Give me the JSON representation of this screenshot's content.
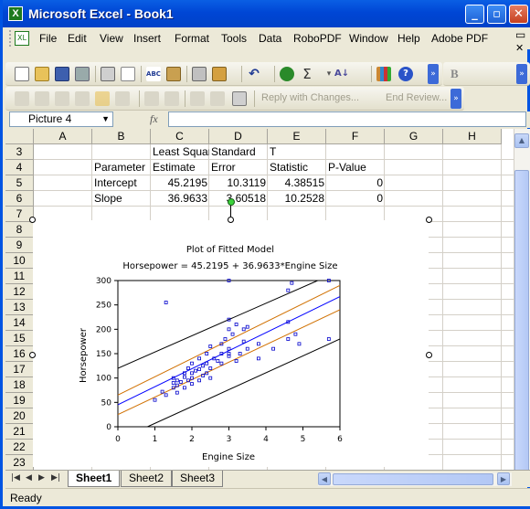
{
  "window": {
    "title": "Microsoft Excel - Book1",
    "app_icon": "X"
  },
  "menu": {
    "items": [
      "File",
      "Edit",
      "View",
      "Insert",
      "Format",
      "Tools",
      "Data",
      "RoboPDF",
      "Window",
      "Help",
      "Adobe PDF"
    ],
    "mdi_minimize": "▭",
    "mdi_close": "✕"
  },
  "toolbar2": {
    "reply_label": "Reply with Changes...",
    "end_review_label": "End Review..."
  },
  "formula_bar": {
    "name_box": "Picture 4",
    "fx": "fx",
    "content": ""
  },
  "sheet": {
    "columns": [
      "A",
      "B",
      "C",
      "D",
      "E",
      "F",
      "G",
      "H"
    ],
    "rows": [
      "3",
      "4",
      "5",
      "6",
      "7",
      "8",
      "9",
      "10",
      "11",
      "12",
      "13",
      "14",
      "15",
      "16",
      "17",
      "18",
      "19",
      "20",
      "21",
      "22",
      "23"
    ],
    "cells": {
      "C3": "Least Squares",
      "D3": "Standard",
      "E3": "T",
      "B4": "Parameter",
      "C4": "Estimate",
      "D4": "Error",
      "E4": "Statistic",
      "F4": "P-Value",
      "B5": "Intercept",
      "C5": "45.2195",
      "D5": "10.3119",
      "E5": "4.38515",
      "F5": "0",
      "B6": "Slope",
      "C6": "36.9633",
      "D6": "3.60518",
      "E6": "10.2528",
      "F6": "0"
    }
  },
  "chart_data": {
    "type": "scatter",
    "title": "Plot of Fitted Model",
    "subtitle": "Horsepower = 45.2195 + 36.9633*Engine Size",
    "xlabel": "Engine Size",
    "ylabel": "Horsepower",
    "xlim": [
      0,
      6
    ],
    "ylim": [
      0,
      300
    ],
    "xticks": [
      0,
      1,
      2,
      3,
      4,
      5,
      6
    ],
    "yticks": [
      0,
      50,
      100,
      150,
      200,
      250,
      300
    ],
    "fit": {
      "intercept": 45.2195,
      "slope": 36.9633
    },
    "confidence_band": {
      "lower": [
        [
          0,
          25
        ],
        [
          6,
          240
        ]
      ],
      "upper": [
        [
          0,
          65
        ],
        [
          6,
          290
        ]
      ]
    },
    "prediction_band": {
      "lower": [
        [
          0.8,
          0
        ],
        [
          6,
          180
        ]
      ],
      "upper": [
        [
          0,
          120
        ],
        [
          5.4,
          300
        ]
      ]
    },
    "colors": {
      "points": "#0000cc",
      "fit": "#0000ff",
      "confidence": "#d07000",
      "prediction": "#000000"
    },
    "points": [
      [
        1.0,
        55
      ],
      [
        1.2,
        72
      ],
      [
        1.3,
        65
      ],
      [
        1.3,
        255
      ],
      [
        1.5,
        80
      ],
      [
        1.5,
        90
      ],
      [
        1.5,
        100
      ],
      [
        1.6,
        70
      ],
      [
        1.6,
        95
      ],
      [
        1.6,
        85
      ],
      [
        1.7,
        92
      ],
      [
        1.8,
        80
      ],
      [
        1.8,
        110
      ],
      [
        1.8,
        102
      ],
      [
        1.9,
        95
      ],
      [
        1.9,
        120
      ],
      [
        2.0,
        100
      ],
      [
        2.0,
        110
      ],
      [
        2.0,
        130
      ],
      [
        2.0,
        88
      ],
      [
        2.1,
        115
      ],
      [
        2.2,
        140
      ],
      [
        2.2,
        118
      ],
      [
        2.2,
        95
      ],
      [
        2.3,
        125
      ],
      [
        2.3,
        105
      ],
      [
        2.4,
        130
      ],
      [
        2.4,
        150
      ],
      [
        2.4,
        110
      ],
      [
        2.5,
        120
      ],
      [
        2.5,
        100
      ],
      [
        2.5,
        165
      ],
      [
        2.6,
        140
      ],
      [
        2.7,
        135
      ],
      [
        2.8,
        150
      ],
      [
        2.8,
        170
      ],
      [
        2.8,
        130
      ],
      [
        2.9,
        180
      ],
      [
        3.0,
        200
      ],
      [
        3.0,
        150
      ],
      [
        3.0,
        145
      ],
      [
        3.0,
        160
      ],
      [
        3.0,
        220
      ],
      [
        3.0,
        300
      ],
      [
        3.1,
        190
      ],
      [
        3.2,
        210
      ],
      [
        3.2,
        135
      ],
      [
        3.3,
        150
      ],
      [
        3.4,
        175
      ],
      [
        3.4,
        200
      ],
      [
        3.5,
        205
      ],
      [
        3.5,
        160
      ],
      [
        3.8,
        140
      ],
      [
        3.8,
        170
      ],
      [
        4.2,
        160
      ],
      [
        4.6,
        215
      ],
      [
        4.6,
        180
      ],
      [
        4.6,
        280
      ],
      [
        4.7,
        295
      ],
      [
        4.8,
        190
      ],
      [
        4.9,
        170
      ],
      [
        5.7,
        180
      ],
      [
        5.7,
        300
      ]
    ]
  },
  "tabs": [
    "Sheet1",
    "Sheet2",
    "Sheet3"
  ],
  "status": "Ready"
}
